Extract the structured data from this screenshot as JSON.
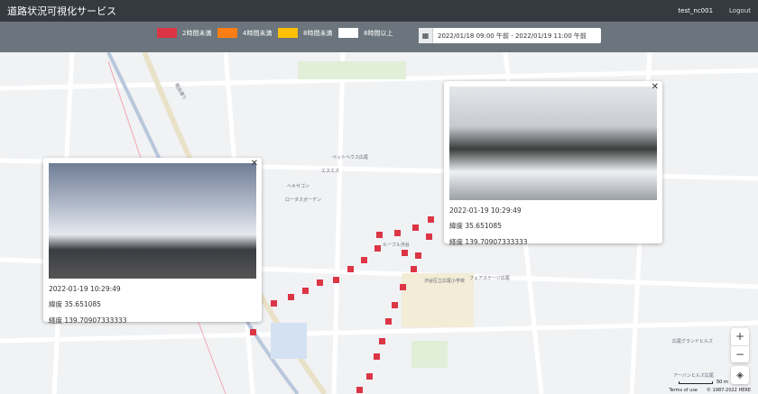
{
  "header": {
    "title": "道路状況可視化サービス",
    "user": "test_nc001",
    "logout": "Logout"
  },
  "legend": [
    {
      "label": "2時間未満",
      "color": "#dc3545"
    },
    {
      "label": "4時間未満",
      "color": "#fd7e14"
    },
    {
      "label": "8時間未満",
      "color": "#ffc107"
    },
    {
      "label": "8時間以上",
      "color": "#ffffff"
    }
  ],
  "date_range": {
    "icon": "calendar-icon",
    "value": "2022/01/18 09:00 午前 - 2022/01/19 11:00 午前"
  },
  "popups": [
    {
      "timestamp": "2022-01-19 10:29:49",
      "lat": "緯度 35.651085",
      "lng": "経度 139.70907333333"
    },
    {
      "timestamp": "2022-01-19 10:29:49",
      "lat": "緯度 35.651085",
      "lng": "経度 139.70907333333"
    }
  ],
  "map": {
    "labels": [
      "明治通り",
      "渋谷区立広尾小学校",
      "広尾グランドヒルズ",
      "アーバンヒルズ広尾",
      "ルーブル渋谷",
      "エスエス",
      "フェアステージ広尾",
      "ヘキサゴン",
      "ロータスガーデン",
      "ペットヘウス広尾"
    ],
    "zoom_in": "+",
    "zoom_out": "−",
    "scale": "50 m",
    "terms": "Terms of use",
    "copyright": "© 1987-2022 HERE"
  }
}
